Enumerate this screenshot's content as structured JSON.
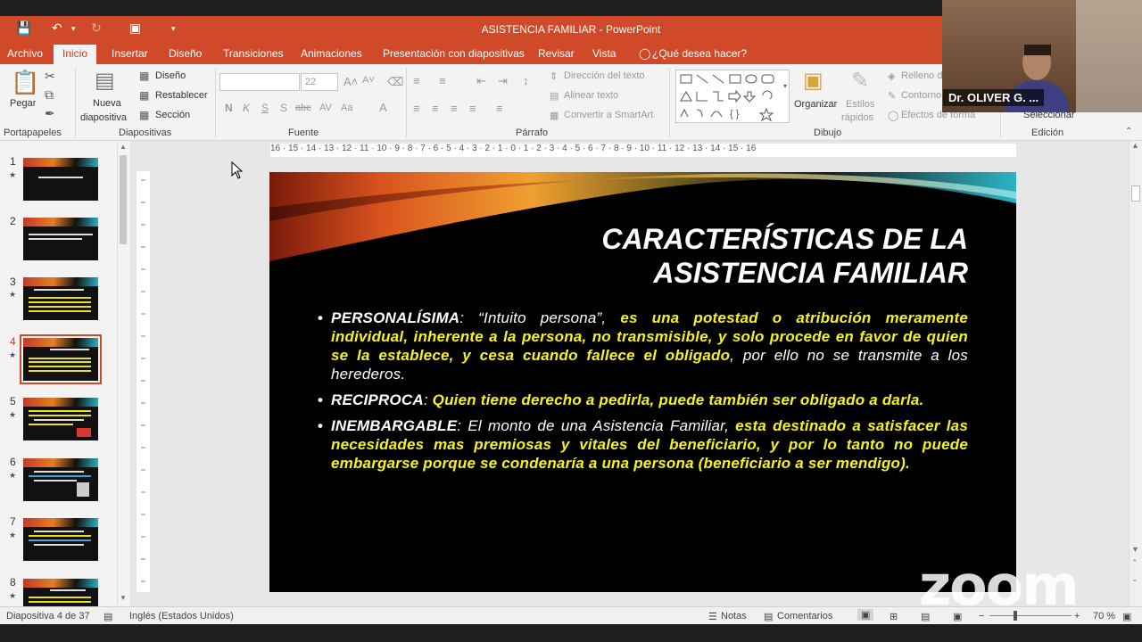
{
  "window": {
    "title": "ASISTENCIA FAMILIAR - PowerPoint"
  },
  "tabs": [
    "Archivo",
    "Inicio",
    "Insertar",
    "Diseño",
    "Transiciones",
    "Animaciones",
    "Presentación con diapositivas",
    "Revisar",
    "Vista",
    "¿Qué desea hacer?"
  ],
  "active_tab": "Inicio",
  "ribbon": {
    "portapapeles": {
      "label": "Portapapeles",
      "pegar": "Pegar"
    },
    "diapositivas": {
      "label": "Diapositivas",
      "nueva": "Nueva",
      "diapositiva": "diapositiva",
      "diseno": "Diseño",
      "restablecer": "Restablecer",
      "seccion": "Sección"
    },
    "fuente": {
      "label": "Fuente",
      "size": "22"
    },
    "parrafo": {
      "label": "Párrafo",
      "direccion": "Dirección del texto",
      "alinear": "Alinear texto",
      "convertir": "Convertir a SmartArt"
    },
    "dibujo": {
      "label": "Dibujo",
      "organizar": "Organizar",
      "estilos": "Estilos",
      "rapidos": "rápidos",
      "relleno": "Relleno d",
      "contorno": "Contorno",
      "efectos": "Efectos de forma"
    },
    "edicion": {
      "label": "Edición",
      "seleccionar": "Seleccionar"
    }
  },
  "ruler": {
    "h": "16 · 15 · 14 · 13 · 12 · 11 · 10 · 9 · 8 · 7 · 6 · 5 · 4 · 3 · 2 · 1 · 0 · 1 · 2 · 3 · 4 · 5 · 6 · 7 · 8 · 9 · 10 · 11 · 12 · 13 · 14 · 15 · 16"
  },
  "thumbnails": [
    {
      "num": "1"
    },
    {
      "num": "2"
    },
    {
      "num": "3"
    },
    {
      "num": "4",
      "selected": true
    },
    {
      "num": "5"
    },
    {
      "num": "6"
    },
    {
      "num": "7"
    },
    {
      "num": "8"
    }
  ],
  "slide": {
    "title_line1": "CARACTERÍSTICAS DE LA",
    "title_line2": "ASISTENCIA FAMILIAR",
    "b1_kw": "PERSONALÍSIMA",
    "b1_a": ": “Intuito persona”, ",
    "b1_y": "es una potestad o atribución meramente individual, inherente a la persona, no transmisible, y solo procede en favor de quien se la establece, y cesa cuando fallece el obligado",
    "b1_b": ", por ello no se transmite a los herederos.",
    "b2_kw": "RECIPROCA",
    "b2_a": ": ",
    "b2_y": "Quien tiene derecho a pedirla, puede también ser obligado a darla.",
    "b3_kw": "INEMBARGABLE",
    "b3_a": ": El monto de una Asistencia Familiar, ",
    "b3_y": "esta destinado a satisfacer las necesidades mas premiosas y vitales del beneficiario, y por lo tanto  no puede embargarse porque se condenaría a una persona (beneficiario a ser mendigo)."
  },
  "status": {
    "slide": "Diapositiva 4 de 37",
    "lang": "Inglés (Estados Unidos)",
    "notas": "Notas",
    "comentarios": "Comentarios",
    "zoom": "70 %"
  },
  "video": {
    "participant": "Dr. OLIVER G. ...",
    "watermark": "zoom"
  }
}
